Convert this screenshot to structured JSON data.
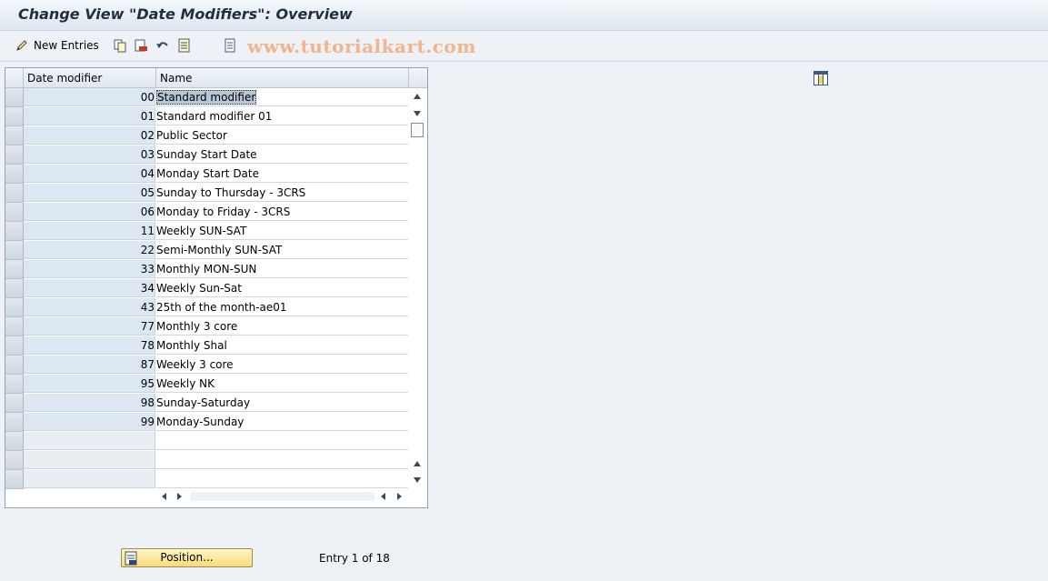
{
  "title": "Change View \"Date Modifiers\": Overview",
  "toolbar": {
    "new_entries": "New Entries",
    "watermark": "www.tutorialkart.com"
  },
  "table": {
    "headers": [
      "Date modifier",
      "Name"
    ],
    "rows": [
      {
        "code": "00",
        "name": "Standard modifier"
      },
      {
        "code": "01",
        "name": "Standard modifier 01"
      },
      {
        "code": "02",
        "name": "Public Sector"
      },
      {
        "code": "03",
        "name": "Sunday Start Date"
      },
      {
        "code": "04",
        "name": "Monday Start Date"
      },
      {
        "code": "05",
        "name": "Sunday to Thursday - 3CRS"
      },
      {
        "code": "06",
        "name": "Monday to Friday - 3CRS"
      },
      {
        "code": "11",
        "name": "Weekly SUN-SAT"
      },
      {
        "code": "22",
        "name": "Semi-Monthly SUN-SAT"
      },
      {
        "code": "33",
        "name": "Monthly MON-SUN"
      },
      {
        "code": "34",
        "name": "Weekly Sun-Sat"
      },
      {
        "code": "43",
        "name": "25th of the month-ae01"
      },
      {
        "code": "77",
        "name": "Monthly 3 core"
      },
      {
        "code": "78",
        "name": "Monthly Shal"
      },
      {
        "code": "87",
        "name": "Weekly 3 core"
      },
      {
        "code": "95",
        "name": "Weekly NK"
      },
      {
        "code": "98",
        "name": "Sunday-Saturday"
      },
      {
        "code": "99",
        "name": "Monday-Sunday"
      }
    ]
  },
  "footer": {
    "position_label": "Position...",
    "entry_text": "Entry 1 of 18"
  },
  "colors": {
    "watermark": "#f2b48c",
    "position_button": "#f6dc77",
    "key_column": "#dde7f1"
  }
}
